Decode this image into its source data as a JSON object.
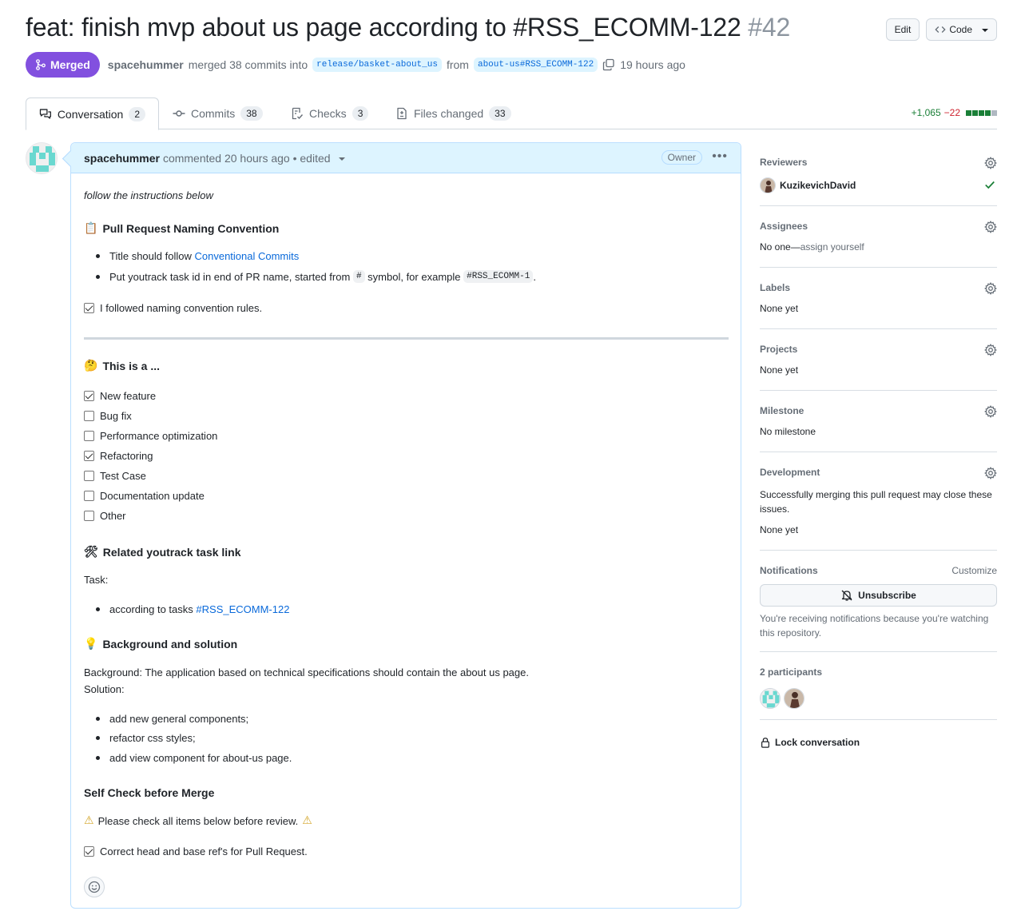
{
  "header": {
    "title": "feat: finish mvp about us page according to #RSS_ECOMM-122",
    "number": "#42",
    "edit_label": "Edit",
    "code_label": "Code"
  },
  "meta": {
    "status": "Merged",
    "author": "spacehummer",
    "action_text": "merged 38 commits into",
    "base_branch": "release/basket-about_us",
    "from_text": "from",
    "head_branch": "about-us#RSS_ECOMM-122",
    "time": "19 hours ago"
  },
  "tabs": [
    {
      "label": "Conversation",
      "count": "2",
      "icon": "comment-discussion-icon"
    },
    {
      "label": "Commits",
      "count": "38",
      "icon": "git-commit-icon"
    },
    {
      "label": "Checks",
      "count": "3",
      "icon": "checklist-icon"
    },
    {
      "label": "Files changed",
      "count": "33",
      "icon": "file-diff-icon"
    }
  ],
  "diffstat": {
    "additions": "+1,065",
    "deletions": "−22",
    "colors": [
      "#1a7f37",
      "#1a7f37",
      "#1a7f37",
      "#1a7f37",
      "#afb8c1"
    ]
  },
  "comment": {
    "author": "spacehummer",
    "meta": "commented 20 hours ago • edited",
    "badge": "Owner",
    "intro": "follow the instructions below",
    "naming_heading": "Pull Request Naming Convention",
    "naming_emoji": "📋",
    "naming_item1_prefix": "Title should follow",
    "naming_item1_link": "Conventional Commits",
    "naming_item2_a": "Put youtrack task id in end of PR name, started from",
    "naming_item2_code1": "#",
    "naming_item2_b": "symbol, for example",
    "naming_item2_code2": "#RSS_ECOMM-1",
    "naming_item2_c": ".",
    "naming_check": "I followed naming convention rules.",
    "type_heading": "This is a ...",
    "type_emoji": "🤔",
    "types": [
      {
        "label": "New feature",
        "checked": true
      },
      {
        "label": "Bug fix",
        "checked": false
      },
      {
        "label": "Performance optimization",
        "checked": false
      },
      {
        "label": "Refactoring",
        "checked": true
      },
      {
        "label": "Test Case",
        "checked": false
      },
      {
        "label": "Documentation update",
        "checked": false
      },
      {
        "label": "Other",
        "checked": false
      }
    ],
    "task_heading": "Related youtrack task link",
    "task_emoji": "🛠",
    "task_label": "Task:",
    "task_item_prefix": "according to tasks",
    "task_item_link": "#RSS_ECOMM-122",
    "bg_heading": "Background and solution",
    "bg_emoji": "💡",
    "bg_line1": "Background: The application based on technical specifications should contain the about us page.",
    "bg_line2": "Solution:",
    "solutions": [
      "add new general components;",
      "refactor css styles;",
      "add view component for about-us page."
    ],
    "self_heading": "Self Check before Merge",
    "warn_text": "Please check all items below before review.",
    "warn_emoji": "⚠",
    "self_check": "Correct head and base ref's for Pull Request."
  },
  "sidebar": {
    "reviewers_title": "Reviewers",
    "reviewer": "KuzikevichDavid",
    "assignees_title": "Assignees",
    "assignees_none": "No one—",
    "assign_self": "assign yourself",
    "labels_title": "Labels",
    "labels_val": "None yet",
    "projects_title": "Projects",
    "projects_val": "None yet",
    "milestone_title": "Milestone",
    "milestone_val": "No milestone",
    "dev_title": "Development",
    "dev_text": "Successfully merging this pull request may close these issues.",
    "dev_val": "None yet",
    "notif_title": "Notifications",
    "customize": "Customize",
    "unsubscribe": "Unsubscribe",
    "notif_text": "You're receiving notifications because you're watching this repository.",
    "participants": "2 participants",
    "lock": "Lock conversation"
  }
}
